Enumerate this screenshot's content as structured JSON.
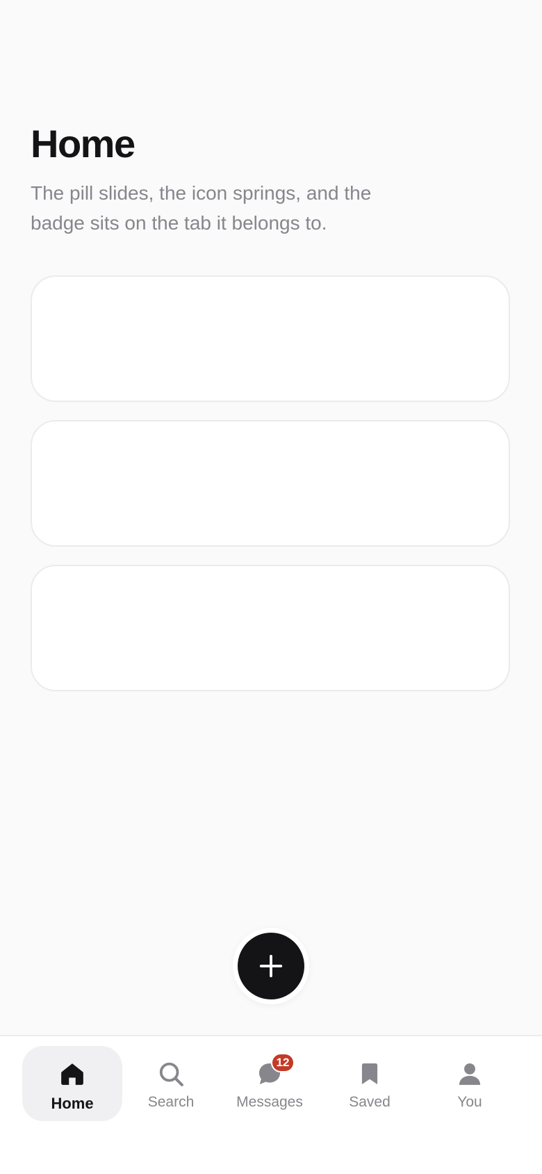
{
  "header": {
    "title": "Home",
    "subtitle": "The pill slides, the icon springs, and the badge sits on the tab it belongs to."
  },
  "cards": [
    {
      "id": "card-1"
    },
    {
      "id": "card-2"
    },
    {
      "id": "card-3"
    }
  ],
  "fab": {
    "icon": "plus-icon"
  },
  "tabbar": {
    "active": "Home",
    "tabs": [
      {
        "label": "Home",
        "icon": "home-icon"
      },
      {
        "label": "Search",
        "icon": "search-icon"
      },
      {
        "label": "Messages",
        "icon": "chat-bubble-icon",
        "badge": "12"
      },
      {
        "label": "Saved",
        "icon": "bookmark-icon"
      },
      {
        "label": "You",
        "icon": "person-icon"
      }
    ]
  },
  "colors": {
    "background": "#fafafa",
    "text_primary": "#141416",
    "text_secondary": "#86868c",
    "active_pill": "#f0f0f2",
    "fab": "#141416",
    "badge": "#c33a26"
  }
}
